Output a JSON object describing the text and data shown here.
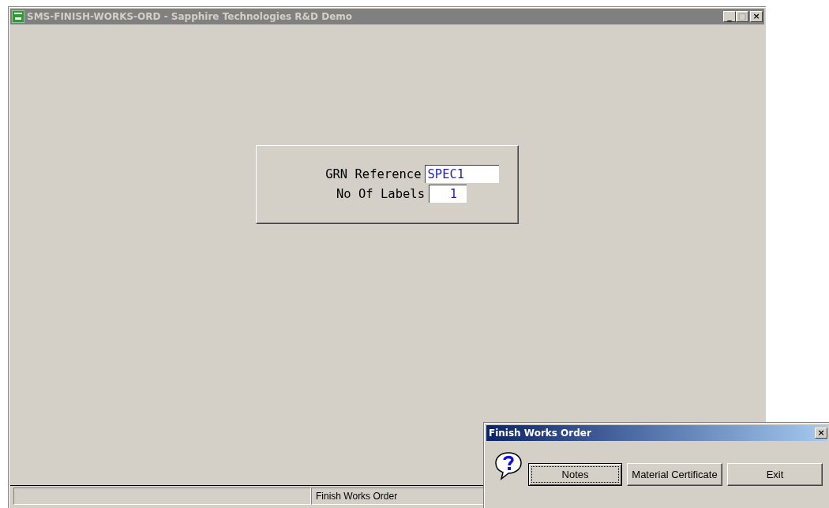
{
  "window": {
    "title": "SMS-FINISH-WORKS-ORD - Sapphire Technologies R&D Demo",
    "controls": {
      "minimize": "_",
      "maximize": "□",
      "close": "×"
    }
  },
  "form": {
    "fields": [
      {
        "label": "GRN Reference",
        "value": "SPEC1",
        "kind": "text"
      },
      {
        "label": "No Of Labels",
        "value": "1",
        "kind": "numeric"
      }
    ]
  },
  "status_bar": {
    "message": "Finish Works Order"
  },
  "dialog": {
    "title": "Finish Works Order",
    "close": "×",
    "buttons": [
      {
        "label": "Notes",
        "focused": true
      },
      {
        "label": "Material Certificate",
        "focused": false
      },
      {
        "label": "Exit",
        "focused": false
      }
    ]
  }
}
